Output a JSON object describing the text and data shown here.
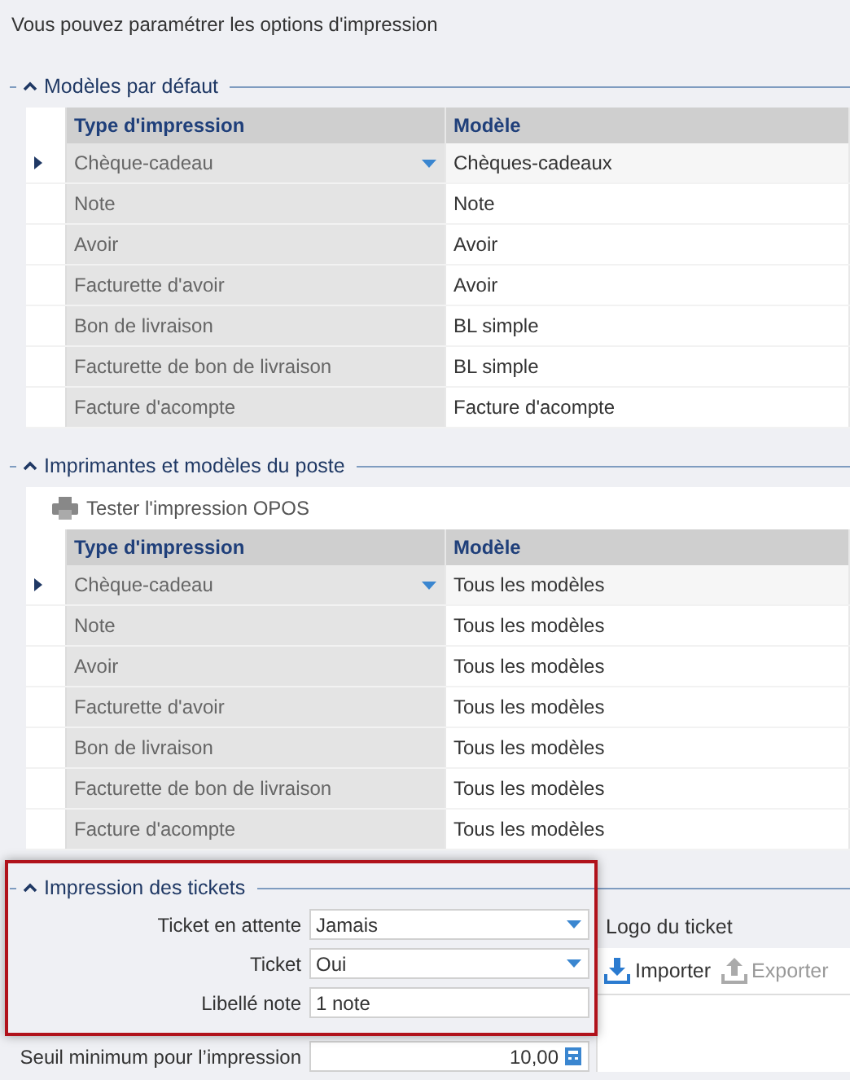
{
  "intro": "Vous pouvez paramétrer les options d'impression",
  "default_models": {
    "title": "Modèles par défaut",
    "expanded": true,
    "columns": [
      "Type d'impression",
      "Modèle"
    ],
    "rows": [
      {
        "type": "Chèque-cadeau",
        "model": "Chèques-cadeaux",
        "selected": true
      },
      {
        "type": "Note",
        "model": "Note",
        "selected": false
      },
      {
        "type": "Avoir",
        "model": "Avoir",
        "selected": false
      },
      {
        "type": "Facturette d'avoir",
        "model": "Avoir",
        "selected": false
      },
      {
        "type": "Bon de livraison",
        "model": "BL simple",
        "selected": false
      },
      {
        "type": "Facturette de bon de livraison",
        "model": "BL simple",
        "selected": false
      },
      {
        "type": "Facture d'acompte",
        "model": "Facture d'acompte",
        "selected": false
      }
    ]
  },
  "station": {
    "title": "Imprimantes et modèles du poste",
    "expanded": true,
    "toolbar_button": "Tester l'impression OPOS",
    "columns": [
      "Type d'impression",
      "Modèle"
    ],
    "rows": [
      {
        "type": "Chèque-cadeau",
        "model": "Tous les modèles",
        "selected": true
      },
      {
        "type": "Note",
        "model": "Tous les modèles",
        "selected": false
      },
      {
        "type": "Avoir",
        "model": "Tous les modèles",
        "selected": false
      },
      {
        "type": "Facturette d'avoir",
        "model": "Tous les modèles",
        "selected": false
      },
      {
        "type": "Bon de livraison",
        "model": "Tous les modèles",
        "selected": false
      },
      {
        "type": "Facturette de bon de livraison",
        "model": "Tous les modèles",
        "selected": false
      },
      {
        "type": "Facture d'acompte",
        "model": "Tous les modèles",
        "selected": false
      }
    ]
  },
  "tickets": {
    "title": "Impression des tickets",
    "expanded": true,
    "fields": [
      {
        "label": "Ticket en attente",
        "value": "Jamais",
        "kind": "dropdown"
      },
      {
        "label": "Ticket",
        "value": "Oui",
        "kind": "dropdown"
      },
      {
        "label": "Libellé note",
        "value": "1 note",
        "kind": "text"
      }
    ],
    "threshold": {
      "label": "Seuil minimum pour l’impression",
      "value": "10,00"
    },
    "logo": {
      "title": "Logo du ticket",
      "buttons": [
        {
          "label": "Importer",
          "disabled": false
        },
        {
          "label": "Exporter",
          "disabled": true
        }
      ]
    }
  }
}
